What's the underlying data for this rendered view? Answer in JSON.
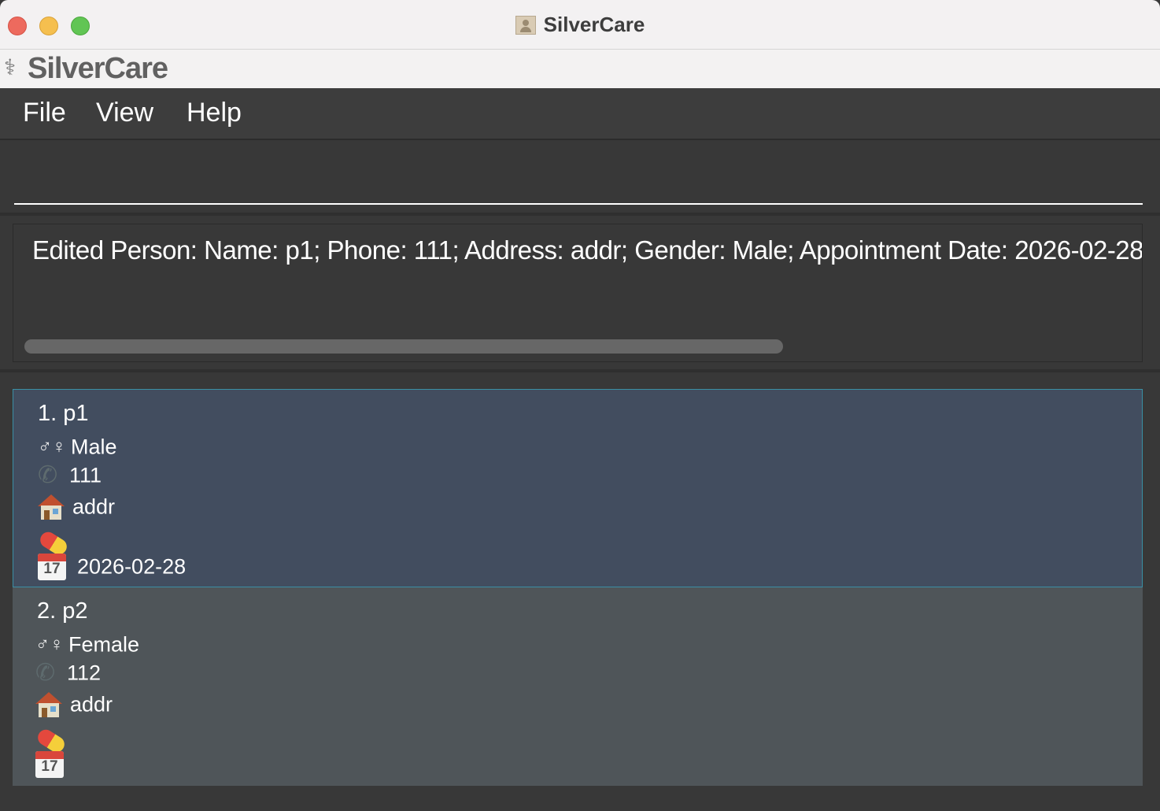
{
  "window": {
    "title": "SilverCare"
  },
  "app": {
    "name": "SilverCare",
    "logo_glyph": "⚕"
  },
  "menu": {
    "items": [
      {
        "label": "File"
      },
      {
        "label": "View"
      },
      {
        "label": "Help"
      }
    ]
  },
  "command": {
    "value": ""
  },
  "result": {
    "text": "Edited Person: Name: p1; Phone: 111; Address: addr; Gender: Male; Appointment Date: 2026-02-28"
  },
  "persons": [
    {
      "index_name": "1. p1",
      "gender": "Male",
      "phone": "111",
      "address": "addr",
      "medicine": "",
      "appointment": "2026-02-28",
      "selected": true
    },
    {
      "index_name": "2. p2",
      "gender": "Female",
      "phone": "112",
      "address": "addr",
      "medicine": "",
      "appointment": "",
      "selected": false
    }
  ],
  "icons": {
    "gender": "⚥-gender-icon",
    "phone": "phone-icon",
    "address": "house-icon",
    "medicine": "pill-icon",
    "appointment": "calendar-icon",
    "calendar_day": "17"
  },
  "colors": {
    "selected_card": "#424d5f",
    "selected_border": "#3a8fa5",
    "card": "#4f5559",
    "background": "#383838"
  }
}
